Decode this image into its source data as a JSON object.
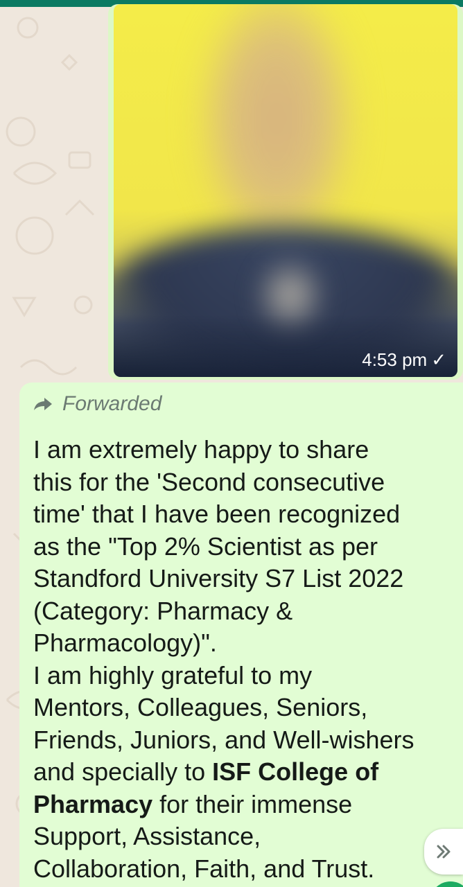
{
  "image_message": {
    "timestamp": "4:53 pm",
    "status_icon": "check-icon"
  },
  "text_message": {
    "forwarded_label": "Forwarded",
    "forwarded_icon": "forward-arrow-icon",
    "line1": "I am extremely happy to share",
    "line2": "this for the 'Second consecutive",
    "line3": "time' that I have been recognized",
    "line4": "as the \"Top 2% Scientist as per",
    "line5": "Standford University S7 List 2022",
    "line6": "(Category: Pharmacy &",
    "line7": "Pharmacology)\".",
    "line8": "I am highly grateful to my",
    "line9": "Mentors, Colleagues, Seniors,",
    "line10": "Friends, Juniors, and Well-wishers",
    "line11a": "and specially to ",
    "line11b": "ISF College of",
    "line12a": "Pharmacy",
    "line12b": " for their immense",
    "line13": "Support, Assistance,",
    "line14": "Collaboration, Faith, and Trust."
  },
  "scroll_button": {
    "icon": "double-chevron-down-icon"
  },
  "colors": {
    "header": "#0b7a62",
    "bubble": "#e2fdd4",
    "wallpaper": "#efe7dd"
  }
}
